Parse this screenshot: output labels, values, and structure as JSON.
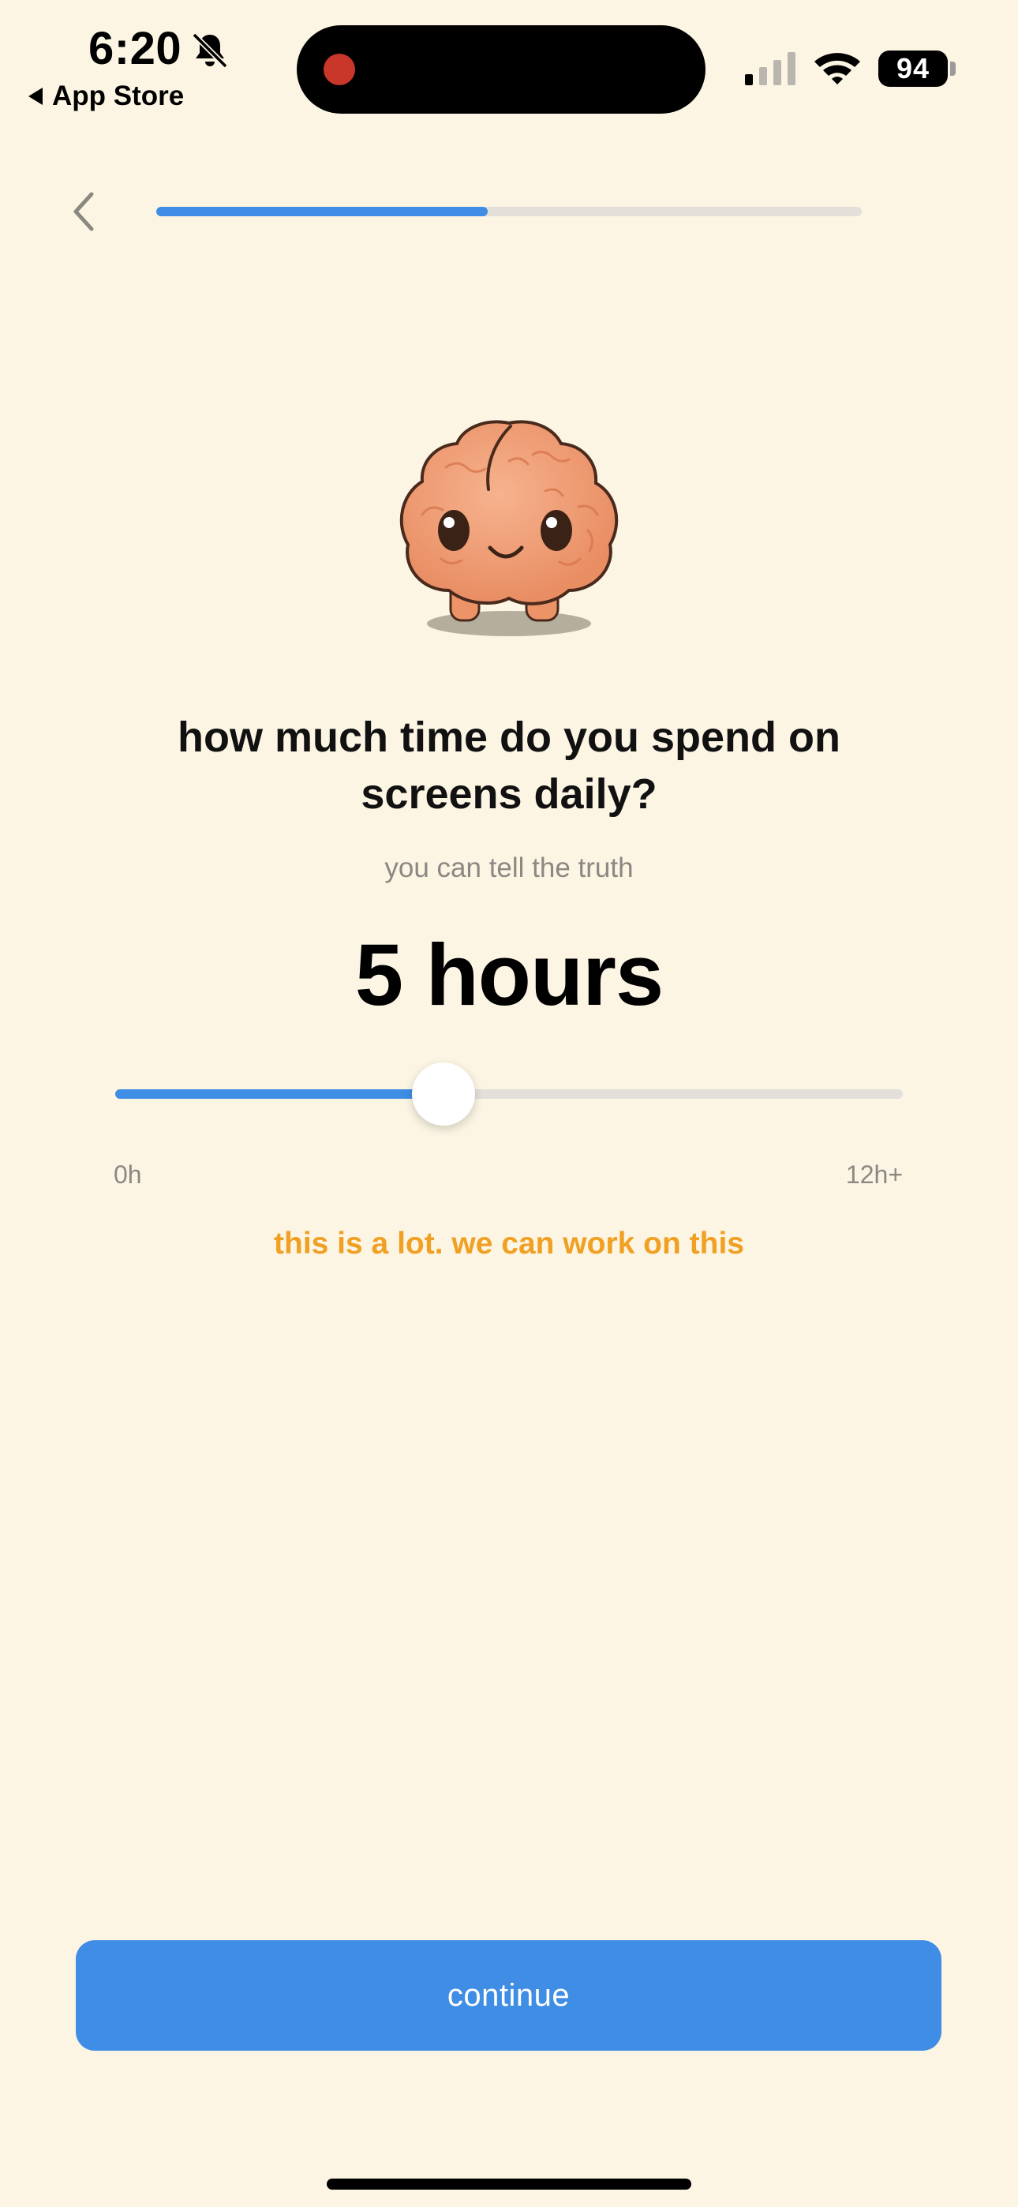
{
  "status_bar": {
    "time": "6:20",
    "back_app_label": "App Store",
    "battery_level": "94",
    "icons": [
      "bell-slash-icon",
      "signal-icon",
      "wifi-icon",
      "battery-icon"
    ],
    "recording_color": "#C8372A"
  },
  "nav": {
    "back_icon": "chevron-left-icon",
    "progress_fraction": 0.47
  },
  "mascot": {
    "icon": "brain-mascot-icon"
  },
  "question": {
    "title": "how much time do you spend on screens daily?",
    "subtitle": "you can tell the truth"
  },
  "slider": {
    "value_label": "5 hours",
    "value_hours": 5,
    "min_label": "0h",
    "max_label": "12h+",
    "min": 0,
    "max": 12
  },
  "feedback": {
    "message": "this is a lot. we can work on this",
    "color": "#F0A023"
  },
  "actions": {
    "continue_label": "continue"
  },
  "colors": {
    "background": "#FCF5E4",
    "accent": "#3F8DE4",
    "track": "#E3E0D9"
  }
}
